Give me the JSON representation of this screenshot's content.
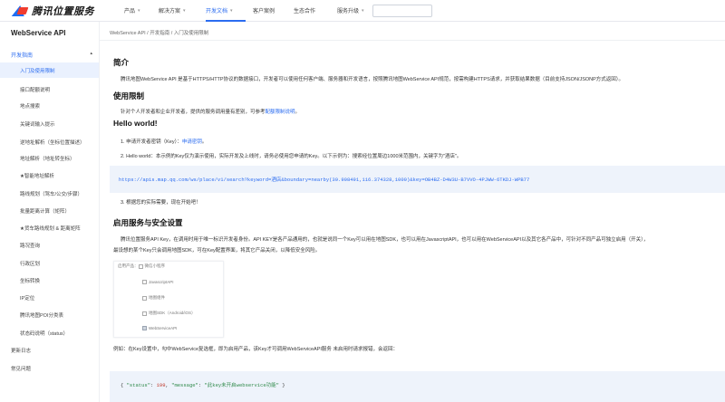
{
  "brand": {
    "name": "腾讯位置服务"
  },
  "topnav": {
    "items": [
      {
        "label": "产品",
        "has_menu": true
      },
      {
        "label": "解决方案",
        "has_menu": true
      },
      {
        "label": "开发文档",
        "has_menu": true,
        "active": true
      },
      {
        "label": "客户案例",
        "has_menu": false
      },
      {
        "label": "生态合作",
        "has_menu": false
      },
      {
        "label": "服务升级",
        "has_menu": true
      }
    ],
    "chevron": "▾",
    "search_placeholder": ""
  },
  "sidebar": {
    "title": "WebService API",
    "section": {
      "label": "开发指南",
      "caret": "▴"
    },
    "items": [
      {
        "label": "入门及使用限制",
        "active": true
      },
      {
        "label": "接口配额说明"
      },
      {
        "label": "地点搜索"
      },
      {
        "label": "关键词输入提示"
      },
      {
        "label": "逆地址解析（坐标位置描述）"
      },
      {
        "label": "地址解析（地址转坐标）"
      },
      {
        "label": "★智能地址解析"
      },
      {
        "label": "路线规划（驾车/公交/步骤）"
      },
      {
        "label": "批量距离计算（矩阵）"
      },
      {
        "label": "★货车路线规划 & 距离矩阵"
      },
      {
        "label": "路况查询"
      },
      {
        "label": "行政区划"
      },
      {
        "label": "坐标转换"
      },
      {
        "label": "IP定位"
      },
      {
        "label": "腾讯地图POI分类表"
      },
      {
        "label": "状态码说明（status）"
      }
    ],
    "bottom_items": [
      {
        "label": "更新日志"
      },
      {
        "label": "常见问题"
      }
    ]
  },
  "breadcrumb": "WebService API / 开发指南 / 入门及使用限制",
  "content": {
    "intro": {
      "heading": "简介",
      "text": "腾讯地图WebService API 是基于HTTPS/HTTP协议的数据接口，开发者可以使用任何客户端、服务器和开发语言，按照腾讯地图WebService API规范，按需构建HTTPS请求，并获取结果数据（目前支持JSON/JSONP方式返回）。"
    },
    "limits": {
      "heading": "使用限制",
      "text": "针对个人开发者和企业开发者，提供的服务调用量有差别，可参考",
      "link": "配额限制说明",
      "suffix": "。"
    },
    "hello": {
      "heading": "Hello world!",
      "step1_prefix": "1. 申请开发者密钥（Key）：",
      "step1_link": "申请密钥",
      "step1_suffix": "。",
      "step2": "2. Hello world：本示例的Key仅为演示使用，实际开发及上线时，请务必使用您申请的Key。以下示例为：搜索经位置周边1000米范围内，关键字为\"酒店\"。",
      "url": "https://apis.map.qq.com/ws/place/v1/search?keyword=酒店&boundary=nearby(39.908491,116.374328,1000)&key=OB4BZ-D4W3U-B7VVO-4PJWW-6TKDJ-WPB77",
      "step3": "3. 根据您的实际需要，现在开始吧！"
    },
    "security": {
      "heading": "启用服务与安全设置",
      "text_line1": "腾讯位置服务API Key，在调用时用于唯一标识开发者身份。API KEY是各产品通用的，也就是说同一个Key可以用在地图SDK，也可以用在JavascriptAPI，也可以用在WebServiceAPI以及其它各产品中，可针对不同产品可独立启用（开关），",
      "text_line2": "最设想的某个Key只会调用地图SDK，可在Key配置界面，将其它产品关闭，以降低安全风险。",
      "panel": {
        "title": "启用产品：",
        "options": [
          {
            "label": "微信小程序",
            "checked": false
          },
          {
            "label": "JavascriptAPI",
            "checked": false
          },
          {
            "label": "地图组件",
            "checked": false
          },
          {
            "label": "地图SDK（Android/iOS）",
            "checked": false
          },
          {
            "label": "WebServiceAPI",
            "checked": true
          }
        ]
      },
      "example_text": "例如：在Key设置中，勾中WebService复选框，即为启用产品，该Key才可调用WebServiceAPI服务 未启用时请求报错，会返回：",
      "json_open": "{ ",
      "json_status_key": "\"status\"",
      "json_status_val": "199",
      "json_message_key": "\"message\"",
      "json_message_val": "\"此key未开启webservice功能\"",
      "json_close": " }"
    }
  }
}
